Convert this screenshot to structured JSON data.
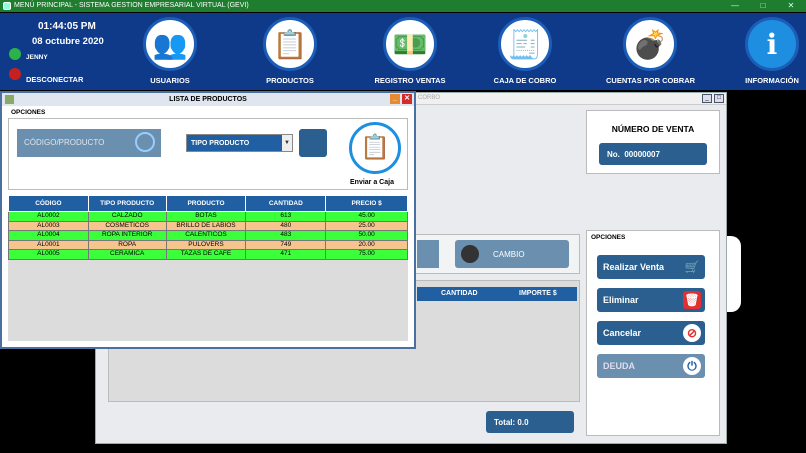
{
  "app": {
    "title": "MENÚ PRINCIPAL - SISTEMA GESTION EMPRESARIAL VIRTUAL (GEVI)",
    "minimize": "—",
    "maximize": "□",
    "close": "✕"
  },
  "header": {
    "time": "01:44:05 PM",
    "date": "08 octubre 2020",
    "user": "JENNY",
    "disconnect": "DESCONECTAR",
    "nav": [
      {
        "label": "USUARIOS",
        "icon": "users-icon",
        "glyph": "👥"
      },
      {
        "label": "PRODUCTOS",
        "icon": "clipboard-boxes-icon",
        "glyph": "📋"
      },
      {
        "label": "REGISTRO VENTAS",
        "icon": "money-stack-icon",
        "glyph": "💵"
      },
      {
        "label": "CAJA DE COBRO",
        "icon": "cash-register-icon",
        "glyph": "🧾"
      },
      {
        "label": "CUENTAS POR COBRAR",
        "icon": "money-bomb-icon",
        "glyph": "💣"
      },
      {
        "label": "INFORMACIÓN",
        "icon": "info-icon",
        "glyph": "i"
      }
    ]
  },
  "sales": {
    "title_fragment": "CORBO",
    "numero_title": "NÚMERO DE VENTA",
    "numero_prefix": "No.",
    "numero_value": "00000007",
    "cambio": "CAMBIO",
    "col_cantidad": "CANTIDAD",
    "col_importe": "IMPORTE $",
    "total": "Total: 0.0",
    "opciones": "OPCIONES",
    "actions": [
      {
        "label": "Realizar Venta",
        "icon": "cart-icon",
        "glyph": "🛒"
      },
      {
        "label": "Eliminar",
        "icon": "trash-icon",
        "glyph": "🗑"
      },
      {
        "label": "Cancelar",
        "icon": "cancel-icon",
        "glyph": "⊘"
      },
      {
        "label": "DEUDA",
        "icon": "power-icon",
        "glyph": "⏻"
      }
    ]
  },
  "products": {
    "title": "LISTA DE PRODUCTOS",
    "opciones": "OPCIONES",
    "search_placeholder": "CÓDIGO/PRODUCTO",
    "tipo": "TIPO PRODUCTO",
    "enviar": "Enviar a Caja",
    "columns": [
      "CÓDIGO",
      "TIPO PRODUCTO",
      "PRODUCTO",
      "CANTIDAD",
      "PRECIO $"
    ],
    "rows": [
      [
        "AL0002",
        "CALZADO",
        "BOTAS",
        "613",
        "45.00"
      ],
      [
        "AL0003",
        "COSMETICOS",
        "BRILLO DE LABIOS",
        "480",
        "25.00"
      ],
      [
        "AL0004",
        "ROPA INTERIOR",
        "CALENTICOS",
        "483",
        "50.00"
      ],
      [
        "AL0001",
        "ROPA",
        "PULOVERS",
        "749",
        "20.00"
      ],
      [
        "AL0005",
        "CERAMICA",
        "TAZAS DE CAFE",
        "471",
        "75.00"
      ]
    ]
  }
}
